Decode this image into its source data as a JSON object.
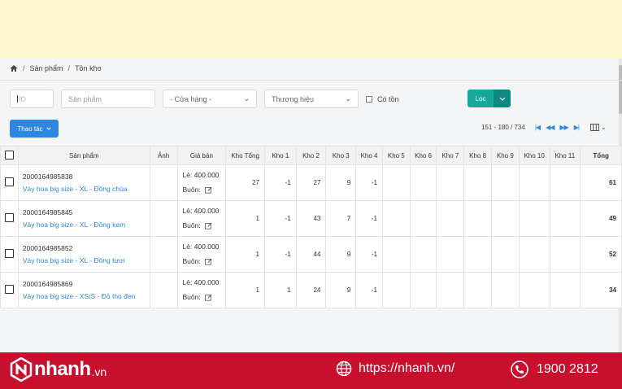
{
  "breadcrumb": [
    "Sản phẩm",
    "Tồn kho"
  ],
  "filters": {
    "id_placeholder": "ID",
    "product_placeholder": "Sản phẩm",
    "store_select": "- Cửa hàng -",
    "brand_select": "Thương hiệu",
    "in_stock_label": "Có tồn",
    "filter_button": "Lọc"
  },
  "actions_button": "Thao tác",
  "pagination": {
    "range": "151 - 180 / 734"
  },
  "table": {
    "headers": [
      "Sản phẩm",
      "Ảnh",
      "Giá bán",
      "Kho Tổng",
      "Kho 1",
      "Kho 2",
      "Kho 3",
      "Kho 4",
      "Kho 5",
      "Kho 6",
      "Kho 7",
      "Kho 8",
      "Kho 9",
      "Kho 10",
      "Kho 11",
      "Tổng"
    ],
    "rows": [
      {
        "sku": "2000164985838",
        "name": "Váy hoa big size - XL - Đồng chùa",
        "retail": "Lẻ: 400.000",
        "wholesale": "Buôn:",
        "kho_tong": "27",
        "kho1": "-1",
        "kho2": "27",
        "kho3": "9",
        "kho4": "-1",
        "total": "61"
      },
      {
        "sku": "2000164985845",
        "name": "Váy hoa big size - XL - Đồng kem",
        "retail": "Lẻ: 400.000",
        "wholesale": "Buôn:",
        "kho_tong": "1",
        "kho1": "-1",
        "kho2": "43",
        "kho3": "7",
        "kho4": "-1",
        "total": "49"
      },
      {
        "sku": "2000164985852",
        "name": "Váy hoa big size - XL - Đồng tươi",
        "retail": "Lẻ: 400.000",
        "wholesale": "Buôn:",
        "kho_tong": "1",
        "kho1": "-1",
        "kho2": "44",
        "kho3": "9",
        "kho4": "-1",
        "total": "52"
      },
      {
        "sku": "2000164985869",
        "name": "Váy hoa big size - XS/S - Đỏ thọ đen",
        "retail": "Lẻ: 400.000",
        "wholesale": "Buôn:",
        "kho_tong": "1",
        "kho1": "1",
        "kho2": "24",
        "kho3": "9",
        "kho4": "-1",
        "total": "34"
      }
    ]
  },
  "banner": {
    "logo_text": "nhanh",
    "logo_suffix": ".vn",
    "website": "https://nhanh.vn/",
    "phone": "1900 2812",
    "brand_color": "#c8102e"
  }
}
